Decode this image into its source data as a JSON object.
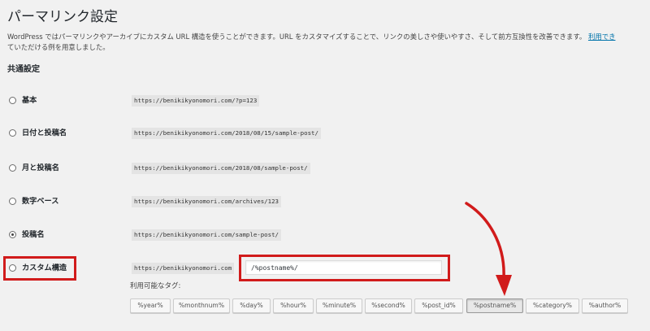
{
  "page": {
    "title": "パーマリンク設定",
    "description_line1": "WordPress ではパーマリンクやアーカイブにカスタム URL 構造を使うことができます。URL をカスタマイズすることで、リンクの美しさや使いやすさ、そして前方互換性を改善できます。",
    "description_link": "利用でき",
    "description_line2": "ていただける例を用意しました。"
  },
  "common_settings": {
    "title": "共通設定",
    "options": [
      {
        "label": "基本",
        "example": "https://benikikyonomori.com/?p=123",
        "checked": false
      },
      {
        "label": "日付と投稿名",
        "example": "https://benikikyonomori.com/2018/08/15/sample-post/",
        "checked": false
      },
      {
        "label": "月と投稿名",
        "example": "https://benikikyonomori.com/2018/08/sample-post/",
        "checked": false
      },
      {
        "label": "数字ベース",
        "example": "https://benikikyonomori.com/archives/123",
        "checked": false
      },
      {
        "label": "投稿名",
        "example": "https://benikikyonomori.com/sample-post/",
        "checked": true
      }
    ],
    "custom": {
      "label": "カスタム構造",
      "prefix": "https://benikikyonomori.com",
      "value": "/%postname%/",
      "checked": false
    },
    "available_tags_label": "利用可能なタグ:",
    "tags": [
      "%year%",
      "%monthnum%",
      "%day%",
      "%hour%",
      "%minute%",
      "%second%",
      "%post_id%",
      "%postname%",
      "%category%",
      "%author%"
    ],
    "active_tag": "%postname%"
  },
  "annotations": {
    "highlight_color": "#d11b1b"
  }
}
